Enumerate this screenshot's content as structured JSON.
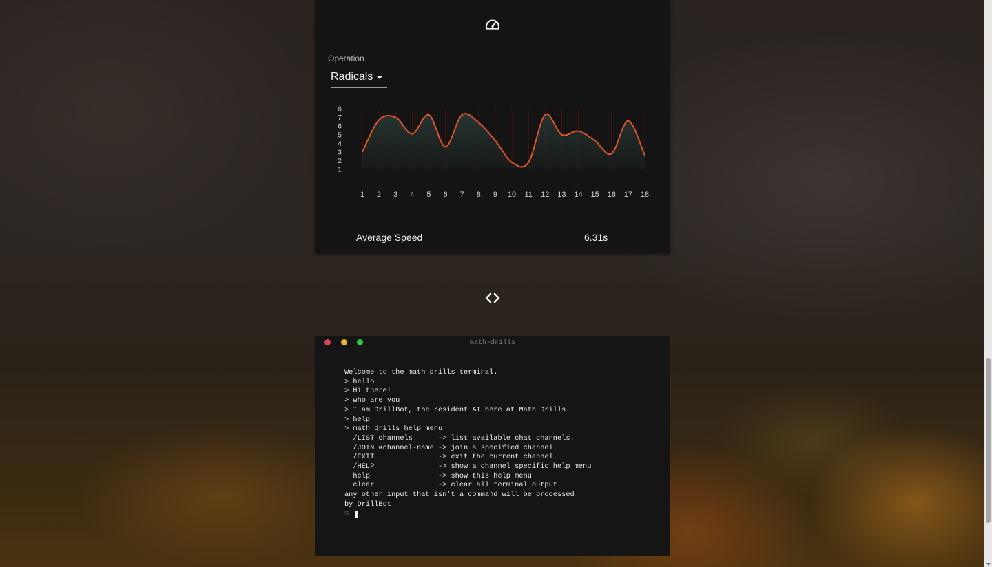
{
  "stats_card": {
    "icon": "speedometer-icon",
    "operation_label": "Operation",
    "operation_value": "Radicals",
    "average_speed_label": "Average Speed",
    "average_speed_value": "6.31s"
  },
  "chart_data": {
    "type": "area",
    "categories": [
      "1",
      "2",
      "3",
      "4",
      "5",
      "6",
      "7",
      "8",
      "9",
      "10",
      "11",
      "12",
      "13",
      "14",
      "15",
      "16",
      "17",
      "18"
    ],
    "series": [
      {
        "values": [
          3.0,
          6.7,
          7.0,
          5.1,
          7.3,
          3.6,
          7.3,
          6.4,
          4.3,
          1.8,
          1.8,
          7.3,
          5.0,
          5.4,
          4.3,
          2.8,
          6.6,
          2.6
        ]
      }
    ],
    "yticks": [
      "8",
      "7",
      "6",
      "5",
      "4",
      "3",
      "2",
      "1"
    ],
    "ylim": [
      1,
      8
    ],
    "line_color": "#e0552a",
    "grid": true
  },
  "toggle_icon": "code-brackets-icon",
  "terminal": {
    "title": "math-drills",
    "lines": [
      "Welcome to the math drills terminal.",
      "> hello",
      "> Hi there!",
      "> who are you",
      "> I am DrillBot, the resident AI here at Math Drills.",
      "> help",
      "> math drills help menu",
      "  /LIST channels      -> list available chat channels.",
      "  /JOIN #channel-name -> join a specified channel.",
      "  /EXIT               -> exit the current channel.",
      "  /HELP               -> show a channel specific help menu",
      "  help                -> show this help menu",
      "  clear               -> clear all terminal output",
      "any other input that isn't a command will be processed",
      "by DrillBot"
    ],
    "prompt": "$",
    "buttons": {
      "close_color": "#e0445a",
      "minimize_color": "#e6b52b",
      "maximize_color": "#2bc840"
    }
  }
}
